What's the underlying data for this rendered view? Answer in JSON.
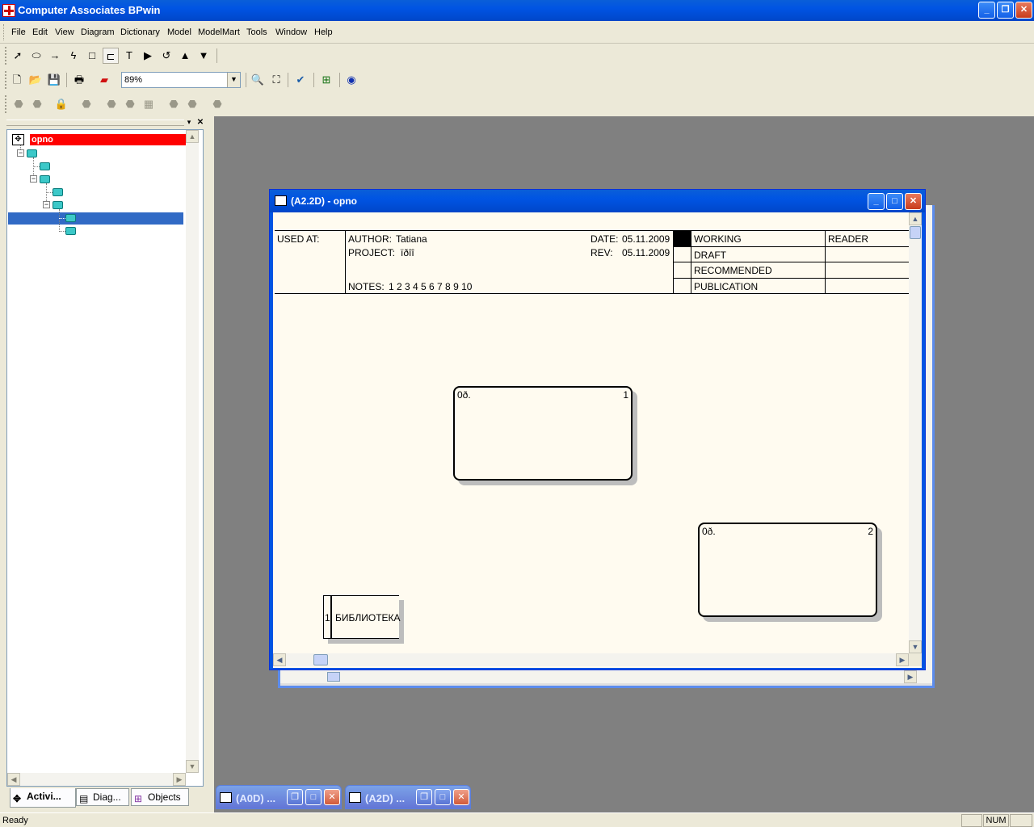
{
  "app": {
    "title": "Computer Associates BPwin"
  },
  "menu": [
    "File",
    "Edit",
    "View",
    "Diagram",
    "Dictionary",
    "Model",
    "ModelMart",
    "Tools",
    "Window",
    "Help"
  ],
  "toolbar": {
    "zoom": "89%"
  },
  "tree": {
    "root": "opno"
  },
  "tabs": [
    "Activi...",
    "Diag...",
    "Objects"
  ],
  "diagram_window": {
    "title": "(A2.2D)  - opno"
  },
  "frame": {
    "used_at": "USED AT:",
    "author_label": "AUTHOR:",
    "author": "Tatiana",
    "project_label": "PROJECT:",
    "project": "ïðîî",
    "date_label": "DATE:",
    "date": "05.11.2009",
    "rev_label": "REV:",
    "rev": "05.11.2009",
    "notes_label": "NOTES:",
    "notes": "1  2  3  4  5  6  7  8  9  10",
    "working": "WORKING",
    "draft": "DRAFT",
    "recommended": "RECOMMENDED",
    "publication": "PUBLICATION",
    "reader": "READER"
  },
  "activities": [
    {
      "cost": "0ð.",
      "num": "1"
    },
    {
      "cost": "0ð.",
      "num": "2"
    }
  ],
  "store": {
    "id": "1",
    "label": "БИБЛИОТЕКА"
  },
  "minimized": [
    {
      "title": "(A0D)  ..."
    },
    {
      "title": "(A2D)  ..."
    }
  ],
  "status": {
    "text": "Ready",
    "num": "NUM"
  }
}
